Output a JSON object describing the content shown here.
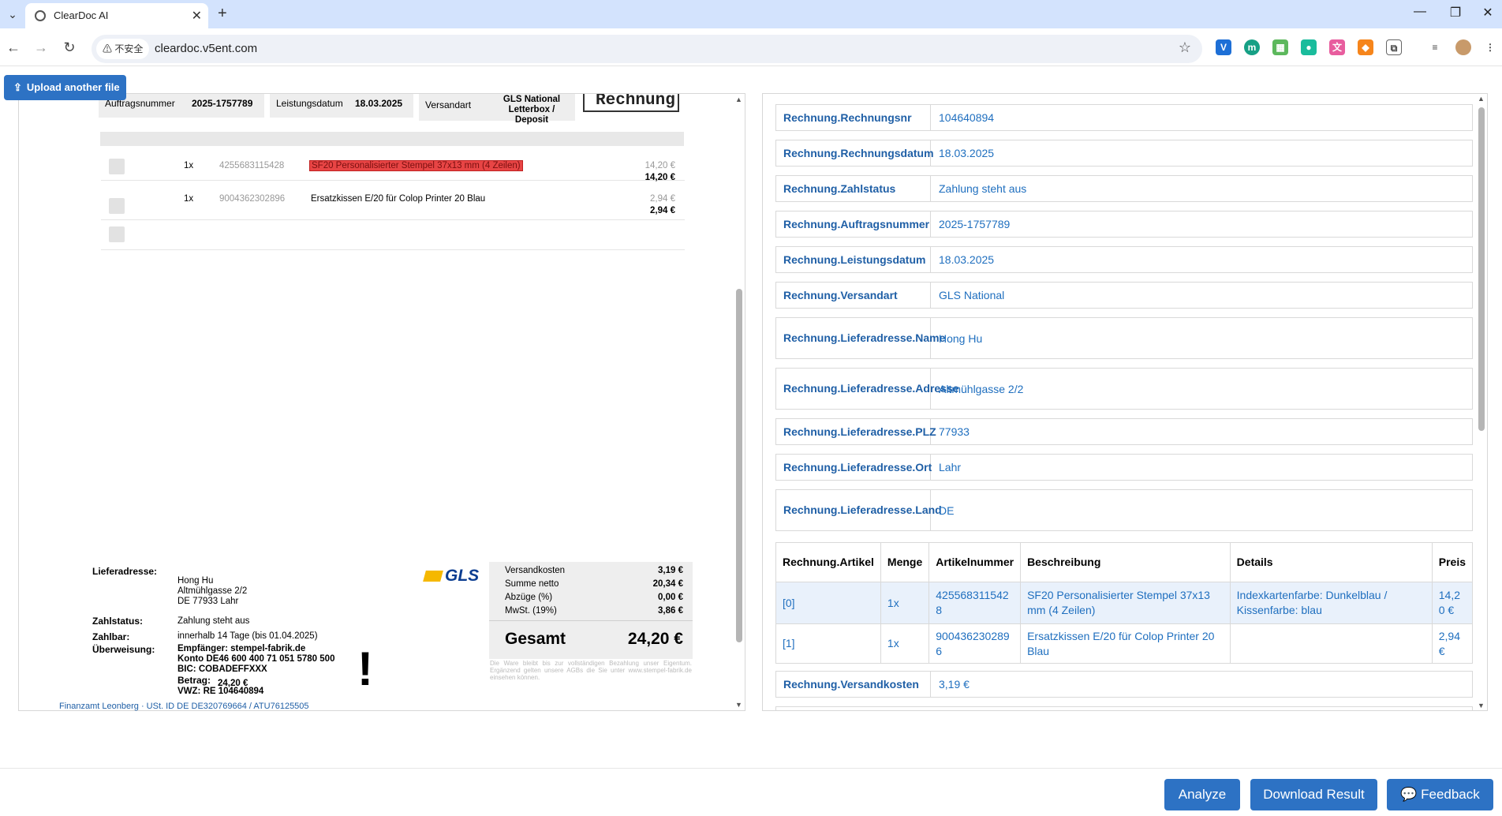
{
  "browser": {
    "tab_title": "ClearDoc AI",
    "security_label": "不安全",
    "url": "cleardoc.v5ent.com"
  },
  "app": {
    "upload_label": "Upload another file",
    "analyze_label": "Analyze",
    "download_label": "Download Result",
    "feedback_label": "Feedback"
  },
  "document": {
    "header_boxes": [
      {
        "label": "Auftragsnummer",
        "value": "2025-1757789"
      },
      {
        "label": "Leistungsdatum",
        "value": "18.03.2025"
      },
      {
        "label": "Versandart",
        "value": "GLS National Letterbox / Deposit"
      }
    ],
    "stamp": "Rechnung",
    "items": [
      {
        "qty": "1x",
        "sku": "4255683115428",
        "desc": "SF20 Personalisierter Stempel 37x13 mm (4 Zeilen)",
        "price_gray": "14,20 €",
        "price": "14,20 €"
      },
      {
        "qty": "1x",
        "sku": "9004362302896",
        "desc": "Ersatzkissen E/20 für Colop Printer 20 Blau",
        "price_gray": "2,94 €",
        "price": "2,94 €"
      }
    ],
    "lieferadresse_label": "Lieferadresse:",
    "lieferadresse": [
      "Hong Hu",
      "Altmühlgasse 2/2",
      "DE 77933 Lahr"
    ],
    "carrier_logo": "GLS",
    "summary": [
      {
        "k": "Versandkosten",
        "v": "3,19 €"
      },
      {
        "k": "Summe netto",
        "v": "20,34 €"
      },
      {
        "k": "Abzüge (%)",
        "v": "0,00 €"
      },
      {
        "k": "MwSt. (19%)",
        "v": "3,86 €"
      }
    ],
    "total_label": "Gesamt",
    "total_value": "24,20 €",
    "disclaimer": "Die Ware bleibt bis zur vollständigen Bezahlung unser Eigentum. Ergänzend gelten unsere AGBs die Sie unter www.stempel-fabrik.de einsehen können.",
    "zahlstatus_label": "Zahlstatus:",
    "zahlstatus": "Zahlung steht aus",
    "zahlbar_label": "Zahlbar:",
    "zahlbar": "innerhalb 14 Tage  (bis 01.04.2025)",
    "ueberweisung_label": "Überweisung:",
    "ueberweisung": [
      "Empfänger: stempel-fabrik.de",
      "Konto DE46 600 400 71 051 5780 500",
      "BIC: COBADEFFXXX"
    ],
    "betrag_label": "Betrag:",
    "betrag": "24,20 €",
    "vwz": "VWZ: RE 104640894",
    "exclamation": "!",
    "finanzamt": "Finanzamt Leonberg · USt. ID DE DE320769664 / ATU76125505"
  },
  "result": {
    "fields": [
      {
        "key": "Rechnung.Rechnungsnr",
        "value": "104640894"
      },
      {
        "key": "Rechnung.Rechnungsdatum",
        "value": "18.03.2025"
      },
      {
        "key": "Rechnung.Zahlstatus",
        "value": "Zahlung steht aus"
      },
      {
        "key": "Rechnung.Auftragsnummer",
        "value": "2025-1757789"
      },
      {
        "key": "Rechnung.Leistungsdatum",
        "value": "18.03.2025"
      },
      {
        "key": "Rechnung.Versandart",
        "value": "GLS National"
      },
      {
        "key": "Rechnung.Lieferadresse.Name",
        "value": "Hong Hu"
      },
      {
        "key": "Rechnung.Lieferadresse.Adresse",
        "value": "Altmühlgasse 2/2"
      },
      {
        "key": "Rechnung.Lieferadresse.PLZ",
        "value": "77933"
      },
      {
        "key": "Rechnung.Lieferadresse.Ort",
        "value": "Lahr"
      },
      {
        "key": "Rechnung.Lieferadresse.Land",
        "value": "DE"
      }
    ],
    "article_headers": [
      "Rechnung.Artikel",
      "Menge",
      "Artikelnummer",
      "Beschreibung",
      "Details",
      "Preis"
    ],
    "articles": [
      {
        "idx": "[0]",
        "menge": "1x",
        "nr": "4255683115428",
        "desc": "SF20 Personalisierter Stempel 37x13 mm (4 Zeilen)",
        "details": "Indexkartenfarbe: Dunkelblau / Kissenfarbe: blau",
        "preis": "14,20 €"
      },
      {
        "idx": "[1]",
        "menge": "1x",
        "nr": "9004362302896",
        "desc": "Ersatzkissen E/20 für Colop Printer 20 Blau",
        "details": "",
        "preis": "2,94 €"
      }
    ],
    "versandkosten_key": "Rechnung.Versandkosten",
    "versandkosten_value": "3,19 €"
  }
}
